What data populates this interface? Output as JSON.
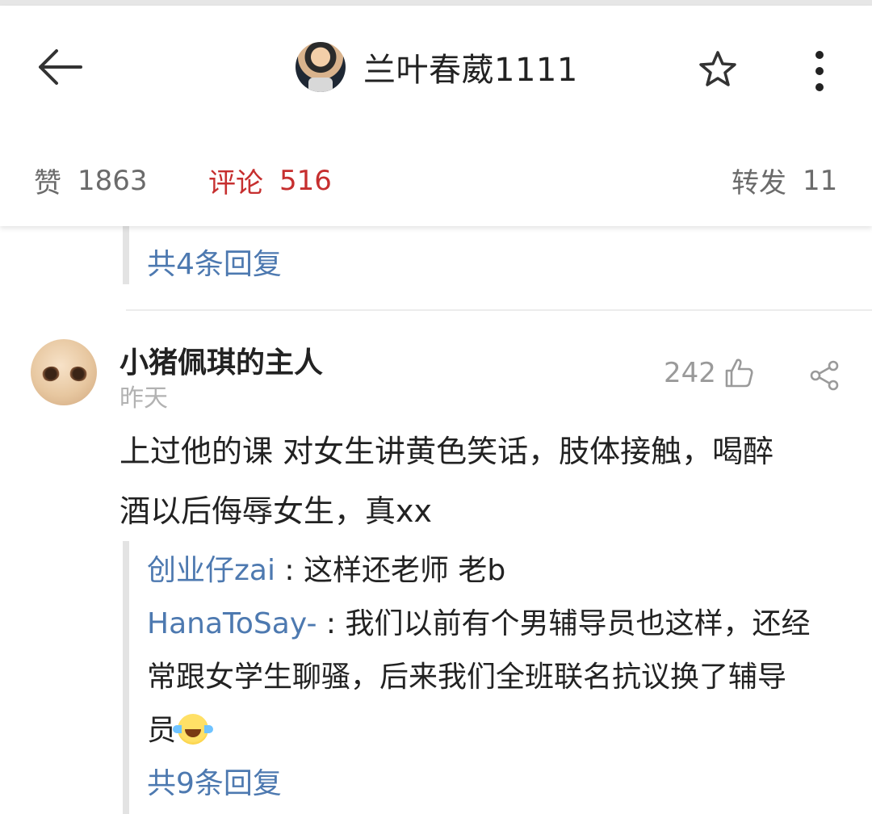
{
  "header": {
    "title": "兰叶春葳1111",
    "back_icon": "arrow-left-icon",
    "favorite_icon": "star-outline-icon",
    "more_icon": "vertical-dots-icon"
  },
  "stats": {
    "likes_label": "赞",
    "likes_count": "1863",
    "comments_label": "评论",
    "comments_count": "516",
    "reposts_label": "转发",
    "reposts_count": "11",
    "active_color": "#c62f2f"
  },
  "prev_thread": {
    "reply_count_text": "共4条回复"
  },
  "comment": {
    "username": "小猪佩琪的主人",
    "time": "昨天",
    "like_count": "242",
    "like_icon": "thumbs-up-icon",
    "share_icon": "share-icon",
    "body_line1": "上过他的课 对女生讲黄色笑话，肢体接触，喝醉",
    "body_line2": "酒以后侮辱女生，真xx",
    "replies": [
      {
        "user": "创业仔zai",
        "sep": " : ",
        "text": "这样还老师 老b"
      },
      {
        "user": "HanaToSay-",
        "sep": " : ",
        "text_line1": "我们以前有个男辅导员也这样，还经",
        "text_line2": "常跟女学生聊骚，后来我们全班联名抗议换了辅导",
        "text_line3": "员",
        "emoji": "laughing-crying-emoji-icon"
      }
    ],
    "reply_count_text": "共9条回复"
  },
  "colors": {
    "link_blue": "#4d79b0",
    "muted_gray": "#b2b2b2"
  }
}
